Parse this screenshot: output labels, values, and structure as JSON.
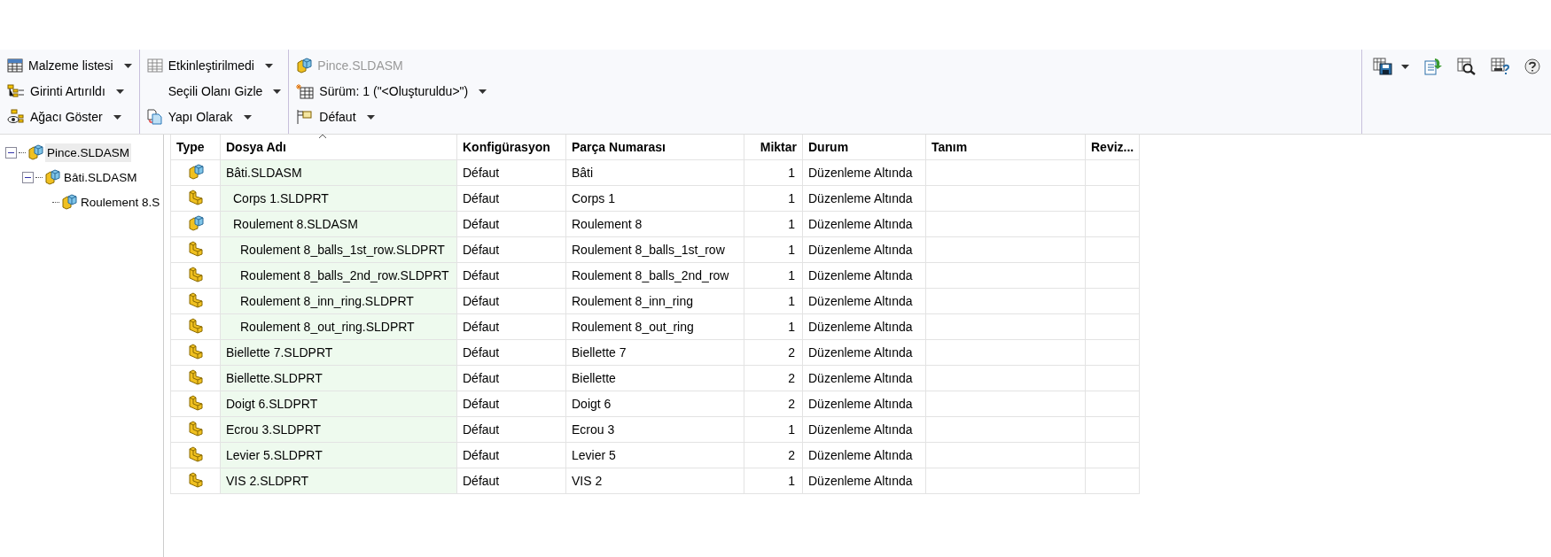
{
  "toolbar": {
    "groups": [
      {
        "items": [
          {
            "kind": "table",
            "label": "Malzeme listesi",
            "dropdown": true,
            "disabled": false
          },
          {
            "kind": "indent",
            "label": "Girinti Artırıldı",
            "dropdown": true,
            "disabled": false
          },
          {
            "kind": "tree-eye",
            "label": "Ağacı Göster",
            "dropdown": true,
            "disabled": false
          }
        ]
      },
      {
        "items": [
          {
            "kind": "table-grey",
            "label": "Etkinleştirilmedi",
            "dropdown": true,
            "disabled": false
          },
          {
            "kind": "none",
            "label": "Seçili Olanı Gizle",
            "dropdown": true,
            "disabled": false
          },
          {
            "kind": "docs",
            "label": "Yapı Olarak",
            "dropdown": true,
            "disabled": false
          }
        ]
      },
      {
        "items": [
          {
            "kind": "assembly",
            "label": "Pince.SLDASM",
            "dropdown": false,
            "disabled": true
          },
          {
            "kind": "version",
            "label": "Sürüm: 1 (\"<Oluşturuldu>\")",
            "dropdown": true,
            "disabled": false
          },
          {
            "kind": "config",
            "label": "Défaut",
            "dropdown": true,
            "disabled": false
          }
        ]
      }
    ],
    "tools": [
      {
        "kind": "save",
        "dropdown": true
      },
      {
        "kind": "export",
        "dropdown": false
      },
      {
        "kind": "preview",
        "dropdown": false
      },
      {
        "kind": "table-help",
        "dropdown": false
      },
      {
        "kind": "help",
        "dropdown": false
      }
    ]
  },
  "tree": [
    {
      "label": "Pince.SLDASM",
      "kind": "assembly",
      "selected": true,
      "expanded": true,
      "children": [
        {
          "label": "Bâti.SLDASM",
          "kind": "assembly",
          "selected": false,
          "expanded": true,
          "children": [
            {
              "label": "Roulement 8.S",
              "kind": "assembly",
              "selected": false
            }
          ]
        }
      ]
    }
  ],
  "table": {
    "columns": [
      "Type",
      "Dosya Adı",
      "Konfigürasyon",
      "Parça Numarası",
      "Miktar",
      "Durum",
      "Tanım",
      "Reviz..."
    ],
    "rows": [
      {
        "kind": "assembly",
        "file": "Bâti.SLDASM",
        "config": "Défaut",
        "part_number": "Bâti",
        "qty": "1",
        "status": "Düzenleme Altında",
        "children": [
          {
            "kind": "part",
            "file": "Corps 1.SLDPRT",
            "config": "Défaut",
            "part_number": "Corps 1",
            "qty": "1",
            "status": "Düzenleme Altında"
          },
          {
            "kind": "assembly",
            "file": "Roulement 8.SLDASM",
            "config": "Défaut",
            "part_number": "Roulement 8",
            "qty": "1",
            "status": "Düzenleme Altında",
            "children": [
              {
                "kind": "part",
                "file": "Roulement 8_balls_1st_row.SLDPRT",
                "config": "Défaut",
                "part_number": "Roulement 8_balls_1st_row",
                "qty": "1",
                "status": "Düzenleme Altında"
              },
              {
                "kind": "part",
                "file": "Roulement 8_balls_2nd_row.SLDPRT",
                "config": "Défaut",
                "part_number": "Roulement 8_balls_2nd_row",
                "qty": "1",
                "status": "Düzenleme Altında"
              },
              {
                "kind": "part",
                "file": "Roulement 8_inn_ring.SLDPRT",
                "config": "Défaut",
                "part_number": "Roulement 8_inn_ring",
                "qty": "1",
                "status": "Düzenleme Altında"
              },
              {
                "kind": "part",
                "file": "Roulement 8_out_ring.SLDPRT",
                "config": "Défaut",
                "part_number": "Roulement 8_out_ring",
                "qty": "1",
                "status": "Düzenleme Altında"
              }
            ]
          }
        ]
      },
      {
        "kind": "part",
        "file": "Biellette 7.SLDPRT",
        "config": "Défaut",
        "part_number": "Biellette 7",
        "qty": "2",
        "status": "Düzenleme Altında"
      },
      {
        "kind": "part",
        "file": "Biellette.SLDPRT",
        "config": "Défaut",
        "part_number": "Biellette",
        "qty": "2",
        "status": "Düzenleme Altında"
      },
      {
        "kind": "part",
        "file": "Doigt 6.SLDPRT",
        "config": "Défaut",
        "part_number": "Doigt 6",
        "qty": "2",
        "status": "Düzenleme Altında"
      },
      {
        "kind": "part",
        "file": "Ecrou 3.SLDPRT",
        "config": "Défaut",
        "part_number": "Ecrou 3",
        "qty": "1",
        "status": "Düzenleme Altında"
      },
      {
        "kind": "part",
        "file": "Levier 5.SLDPRT",
        "config": "Défaut",
        "part_number": "Levier 5",
        "qty": "2",
        "status": "Düzenleme Altında"
      },
      {
        "kind": "part",
        "file": "VIS 2.SLDPRT",
        "config": "Défaut",
        "part_number": "VIS 2",
        "qty": "1",
        "status": "Düzenleme Altında"
      }
    ]
  }
}
